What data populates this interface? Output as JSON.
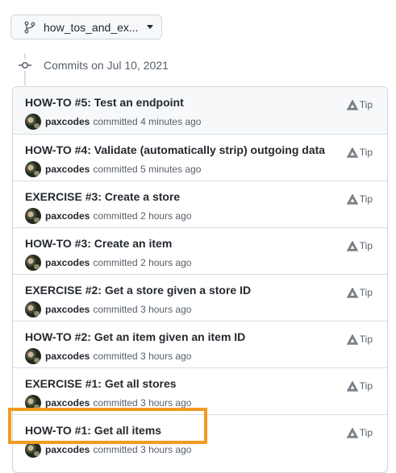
{
  "branch": {
    "name": "how_tos_and_ex...",
    "icon": "git-branch-icon"
  },
  "timeline": {
    "date_label": "Commits on Jul 10, 2021",
    "icon": "git-commit-icon"
  },
  "commits": [
    {
      "title": "HOW-TO #5: Test an endpoint",
      "author": "paxcodes",
      "verb": "committed",
      "time": "4 minutes ago",
      "tip_label": "Tip"
    },
    {
      "title": "HOW-TO #4: Validate (automatically strip) outgoing data",
      "author": "paxcodes",
      "verb": "committed",
      "time": "5 minutes ago",
      "tip_label": "Tip"
    },
    {
      "title": "EXERCISE #3: Create a store",
      "author": "paxcodes",
      "verb": "committed",
      "time": "2 hours ago",
      "tip_label": "Tip"
    },
    {
      "title": "HOW-TO #3: Create an item",
      "author": "paxcodes",
      "verb": "committed",
      "time": "2 hours ago",
      "tip_label": "Tip"
    },
    {
      "title": "EXERCISE #2: Get a store given a store ID",
      "author": "paxcodes",
      "verb": "committed",
      "time": "3 hours ago",
      "tip_label": "Tip"
    },
    {
      "title": "HOW-TO #2: Get an item given an item ID",
      "author": "paxcodes",
      "verb": "committed",
      "time": "3 hours ago",
      "tip_label": "Tip"
    },
    {
      "title": "EXERCISE #1: Get all stores",
      "author": "paxcodes",
      "verb": "committed",
      "time": "3 hours ago",
      "tip_label": "Tip"
    },
    {
      "title": "HOW-TO #1: Get all items",
      "author": "paxcodes",
      "verb": "committed",
      "time": "3 hours ago",
      "tip_label": "Tip"
    }
  ],
  "colors": {
    "highlight": "#f29a1f",
    "text": "#24292f",
    "muted": "#57606a",
    "border": "#d0d7de"
  }
}
